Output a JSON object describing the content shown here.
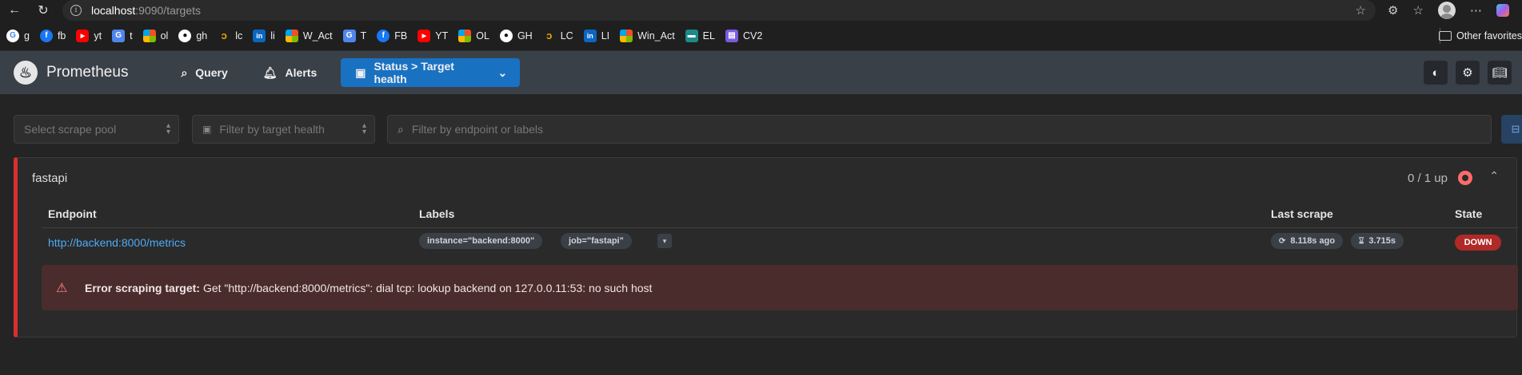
{
  "browser": {
    "url_host": "localhost",
    "url_rest": ":9090/targets",
    "bookmarks": [
      {
        "icon": "google-icon",
        "cls": "g",
        "glyph": "G",
        "label": "g"
      },
      {
        "icon": "facebook-icon",
        "cls": "fb",
        "glyph": "f",
        "label": "fb"
      },
      {
        "icon": "youtube-icon",
        "cls": "yt",
        "glyph": "▶",
        "label": "yt"
      },
      {
        "icon": "translate-icon",
        "cls": "tr",
        "glyph": "G",
        "label": "t"
      },
      {
        "icon": "microsoft-icon",
        "cls": "ms",
        "glyph": "",
        "label": "ol"
      },
      {
        "icon": "github-icon",
        "cls": "gh",
        "glyph": "●",
        "label": "gh"
      },
      {
        "icon": "leetcode-icon",
        "cls": "lc",
        "glyph": "ↄ",
        "label": "lc"
      },
      {
        "icon": "linkedin-icon",
        "cls": "li",
        "glyph": "in",
        "label": "li"
      },
      {
        "icon": "microsoft-icon",
        "cls": "ms",
        "glyph": "",
        "label": "W_Act"
      },
      {
        "icon": "translate-icon",
        "cls": "tr",
        "glyph": "G",
        "label": "T"
      },
      {
        "icon": "facebook-icon",
        "cls": "fb",
        "glyph": "f",
        "label": "FB"
      },
      {
        "icon": "youtube-icon",
        "cls": "yt",
        "glyph": "▶",
        "label": "YT"
      },
      {
        "icon": "microsoft-icon",
        "cls": "ms",
        "glyph": "",
        "label": "OL"
      },
      {
        "icon": "github-icon",
        "cls": "gh",
        "glyph": "●",
        "label": "GH"
      },
      {
        "icon": "leetcode-icon",
        "cls": "lc",
        "glyph": "ↄ",
        "label": "LC"
      },
      {
        "icon": "linkedin-icon",
        "cls": "li",
        "glyph": "in",
        "label": "LI"
      },
      {
        "icon": "microsoft-icon",
        "cls": "ms",
        "glyph": "",
        "label": "Win_Act"
      },
      {
        "icon": "education-icon",
        "cls": "el",
        "glyph": "▬",
        "label": "EL"
      },
      {
        "icon": "document-icon",
        "cls": "cv",
        "glyph": "▤",
        "label": "CV2"
      }
    ],
    "other_favorites": "Other favorites"
  },
  "app": {
    "name": "Prometheus",
    "nav": {
      "query": "Query",
      "alerts": "Alerts",
      "status": "Status > Target health"
    }
  },
  "filters": {
    "scrape_pool_placeholder": "Select scrape pool",
    "health_placeholder": "Filter by target health",
    "search_placeholder": "Filter by endpoint or labels"
  },
  "pool": {
    "name": "fastapi",
    "up_count": "0 / 1 up",
    "columns": {
      "endpoint": "Endpoint",
      "labels": "Labels",
      "last_scrape": "Last scrape",
      "state": "State"
    },
    "target": {
      "endpoint": "http://backend:8000/metrics",
      "labels": [
        "instance=\"backend:8000\"",
        "job=\"fastapi\""
      ],
      "last_scrape": "8.118s ago",
      "duration": "3.715s",
      "state": "DOWN",
      "error_label": "Error scraping target:",
      "error_message": "Get \"http://backend:8000/metrics\": dial tcp: lookup backend on 127.0.0.11:53: no such host"
    }
  },
  "colors": {
    "accent": "#1971c2",
    "link": "#4dabf7",
    "down": "#b02a27",
    "error_bg": "#4b2c2c"
  }
}
